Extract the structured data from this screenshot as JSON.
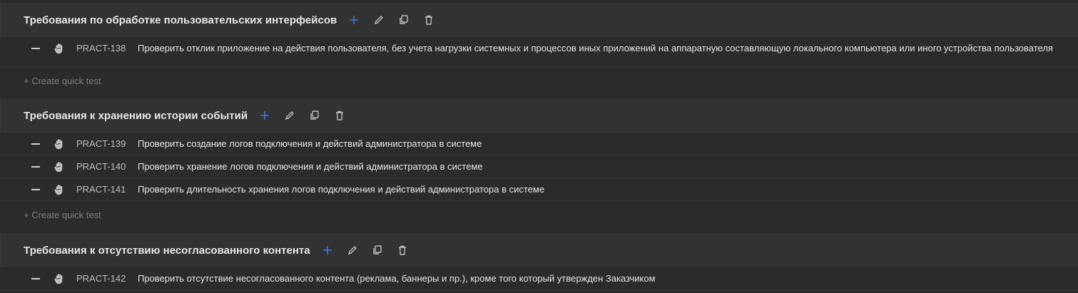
{
  "colors": {
    "background": "#2b2b2b",
    "header_bg": "#323232",
    "accent_plus": "#3b7ddd",
    "icon": "#bfbfbf"
  },
  "quick_test_label": "+ Create quick test",
  "sections": [
    {
      "title": "Требования по обработке пользовательских интерфейсов",
      "tests": [
        {
          "key": "PRACT-138",
          "text": "Проверить отклик приложение на действия пользователя, без учета нагрузки системных и процессов иных приложений на аппаратную составляющую локального компьютера или иного устройства пользователя"
        }
      ]
    },
    {
      "title": "Требования к хранению истории событий",
      "tests": [
        {
          "key": "PRACT-139",
          "text": "Проверить создание логов подключения и действий администратора в системе"
        },
        {
          "key": "PRACT-140",
          "text": "Проверить хранение логов подключения и действий администратора в системе"
        },
        {
          "key": "PRACT-141",
          "text": "Проверить длительность хранения логов подключения и действий администратора в системе"
        }
      ]
    },
    {
      "title": "Требования к отсутствию несогласованного контента",
      "tests": [
        {
          "key": "PRACT-142",
          "text": "Проверить отсутствие несогласованного контента (реклама, баннеры и пр.), кроме того который утвержден Заказчиком"
        }
      ]
    }
  ]
}
